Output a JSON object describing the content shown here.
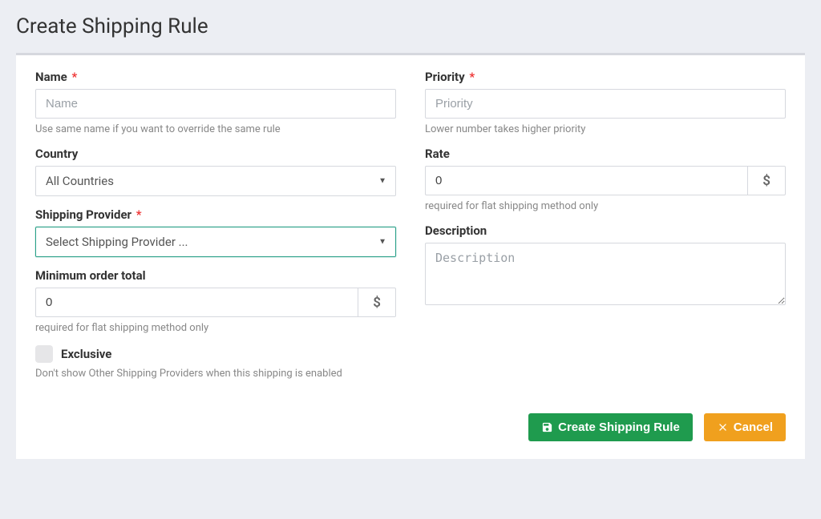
{
  "title": "Create Shipping Rule",
  "left": {
    "name": {
      "label": "Name",
      "required": true,
      "placeholder": "Name",
      "help": "Use same name if you want to override the same rule"
    },
    "country": {
      "label": "Country",
      "value": "All Countries"
    },
    "provider": {
      "label": "Shipping Provider",
      "required": true,
      "value": "Select Shipping Provider ..."
    },
    "min_order": {
      "label": "Minimum order total",
      "value": "0",
      "addon": "$",
      "help": "required for flat shipping method only"
    },
    "exclusive": {
      "label": "Exclusive",
      "help": "Don't show Other Shipping Providers when this shipping is enabled"
    }
  },
  "right": {
    "priority": {
      "label": "Priority",
      "required": true,
      "placeholder": "Priority",
      "help": "Lower number takes higher priority"
    },
    "rate": {
      "label": "Rate",
      "value": "0",
      "addon": "$",
      "help": "required for flat shipping method only"
    },
    "description": {
      "label": "Description",
      "placeholder": "Description"
    }
  },
  "buttons": {
    "create": "Create Shipping Rule",
    "cancel": "Cancel"
  },
  "required_marker": "*"
}
